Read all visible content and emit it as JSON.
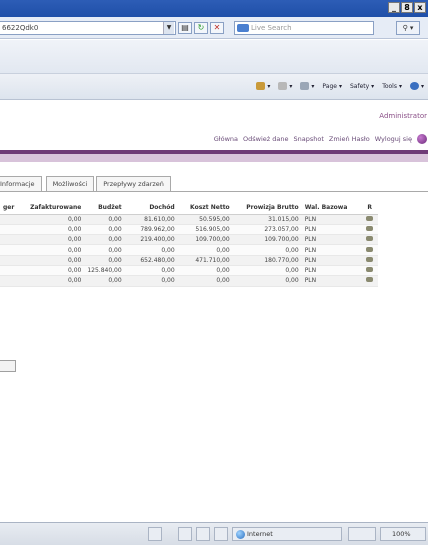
{
  "browser": {
    "url": "6622Qdk0",
    "search_placeholder": "Live Search",
    "window_buttons": [
      "_",
      "8",
      "x"
    ],
    "commands": [
      {
        "label": "Page",
        "icon": "page-icon"
      },
      {
        "label": "Safety",
        "icon": "safety-icon"
      },
      {
        "label": "Tools",
        "icon": "tools-icon"
      }
    ],
    "help_icon": "help-icon"
  },
  "app": {
    "user": "Administrator",
    "top_links": [
      "Główna",
      "Odśwież dane",
      "Snapshot",
      "Zmień Hasło",
      "Wyloguj się"
    ],
    "tabs": [
      "Informacje",
      "Możliwości",
      "Przepływy zdarzeń"
    ]
  },
  "table": {
    "columns": [
      "ger",
      "Zafakturowane",
      "Budżet",
      "Dochód",
      "Koszt Netto",
      "Prowizja Brutto",
      "Wal. Bazowa",
      "R"
    ],
    "rows": [
      [
        "",
        "0,00",
        "0,00",
        "81.610,00",
        "50.595,00",
        "31.015,00",
        "PLN"
      ],
      [
        "",
        "0,00",
        "0,00",
        "789.962,00",
        "516.905,00",
        "273.057,00",
        "PLN"
      ],
      [
        "",
        "0,00",
        "0,00",
        "219.400,00",
        "109.700,00",
        "109.700,00",
        "PLN"
      ],
      [
        "",
        "0,00",
        "0,00",
        "0,00",
        "0,00",
        "0,00",
        "PLN"
      ],
      [
        "",
        "0,00",
        "0,00",
        "652.480,00",
        "471.710,00",
        "180.770,00",
        "PLN"
      ],
      [
        "",
        "0,00",
        "125.840,00",
        "0,00",
        "0,00",
        "0,00",
        "PLN"
      ],
      [
        "",
        "0,00",
        "0,00",
        "0,00",
        "0,00",
        "0,00",
        "PLN"
      ]
    ]
  },
  "status": {
    "zone": "Internet",
    "zoom": "100%"
  }
}
